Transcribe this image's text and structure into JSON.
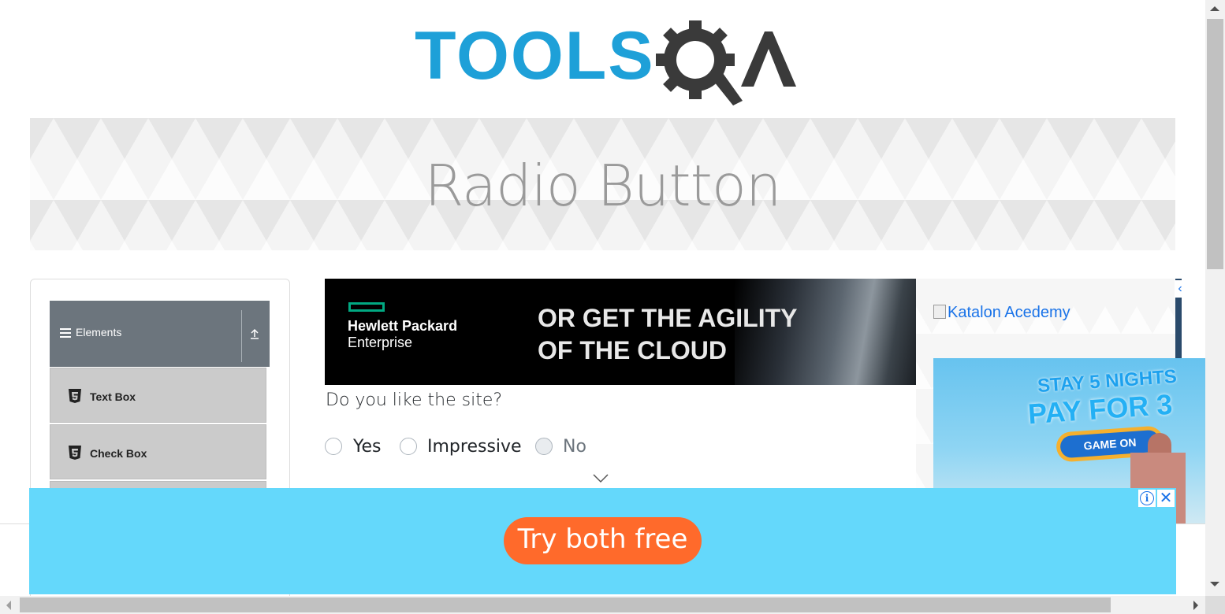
{
  "header": {
    "logo_text": "TOOLSQA",
    "logo_tools": "TOOLS",
    "logo_q": "Q",
    "logo_a": "A",
    "colors": {
      "logo_blue": "#1ea0d8",
      "logo_dark": "#3a3a3a"
    }
  },
  "banner": {
    "title": "Radio Button"
  },
  "sidebar": {
    "group_label": "Elements",
    "group_icon": "hamburger-icon",
    "collapse_icon": "upload-icon",
    "items": [
      {
        "label": "Text Box",
        "icon": "html5-icon"
      },
      {
        "label": "Check Box",
        "icon": "html5-icon"
      }
    ]
  },
  "ad_top": {
    "brand_line1": "Hewlett Packard",
    "brand_line2": "Enterprise",
    "headline_line1": "OR GET THE AGILITY",
    "headline_line2": "OF THE CLOUD",
    "colors": {
      "accent": "#01a982"
    }
  },
  "form": {
    "question": "Do you like the site?",
    "options": [
      {
        "label": "Yes",
        "disabled": false
      },
      {
        "label": "Impressive",
        "disabled": false
      },
      {
        "label": "No",
        "disabled": true
      }
    ]
  },
  "ad_right": {
    "link_text": "Katalon Acedemy",
    "promo_line1": "STAY 5 NIGHTS",
    "promo_line2": "PAY FOR 3",
    "promo_button": "GAME ON"
  },
  "ad_bottom": {
    "button_label": "Try both free",
    "info_icon": "i",
    "close_icon": "✕",
    "colors": {
      "background": "#64d8fb",
      "button": "#ff6a2b"
    }
  }
}
